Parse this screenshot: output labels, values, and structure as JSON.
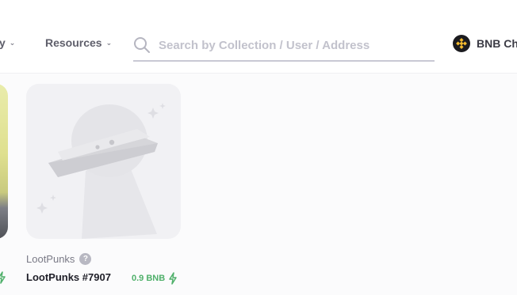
{
  "nav": {
    "partial_label": "y",
    "resources_label": "Resources"
  },
  "search": {
    "placeholder": "Search by Collection / User / Address"
  },
  "chain": {
    "label": "BNB Ch"
  },
  "card": {
    "collection": "LootPunks",
    "item_name": "LootPunks #7907",
    "price": "0.9 BNB"
  },
  "icons": [
    "chevron-down-icon",
    "search-icon",
    "bnb-logo-icon",
    "info-icon",
    "lightning-icon",
    "ufo-placeholder-image"
  ],
  "colors": {
    "price_green": "#4fb06a",
    "bnb_gold": "#f3ba2f"
  }
}
